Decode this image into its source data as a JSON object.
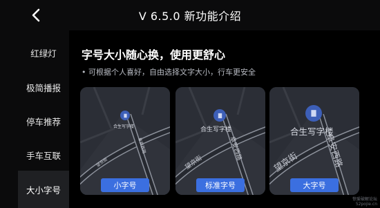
{
  "header": {
    "back_icon": "chevron-left-icon",
    "title": "V 6.5.0 新功能介绍"
  },
  "sidebar": {
    "items": [
      {
        "label": "红绿灯",
        "active": false
      },
      {
        "label": "极简播报",
        "active": false
      },
      {
        "label": "停车推荐",
        "active": false
      },
      {
        "label": "手车互联",
        "active": false
      },
      {
        "label": "大小字号",
        "active": true
      }
    ]
  },
  "main": {
    "headline": "字号大小随心换，使用更舒心",
    "description": "• 可根据个人喜好，自由选择文字大小，行车更安全",
    "cards": [
      {
        "poi": "合生写字楼",
        "street_1": "望京街",
        "street_2": "阜安西路",
        "button": "小字号"
      },
      {
        "poi": "合生写字楼",
        "street_1": "望京街",
        "street_2": "阜安西路",
        "button": "标准字号"
      },
      {
        "poi": "合生写字楼",
        "street_1": "望京街",
        "street_2": "阜安西路",
        "button": "大字号"
      }
    ]
  },
  "watermark": {
    "line1": "惊爱破解论坛",
    "line2": "52pojie.cn"
  },
  "colors": {
    "accent": "#3b6fe0",
    "active_sidebar": "#1f2023",
    "map_bg": "#2b2e36"
  }
}
